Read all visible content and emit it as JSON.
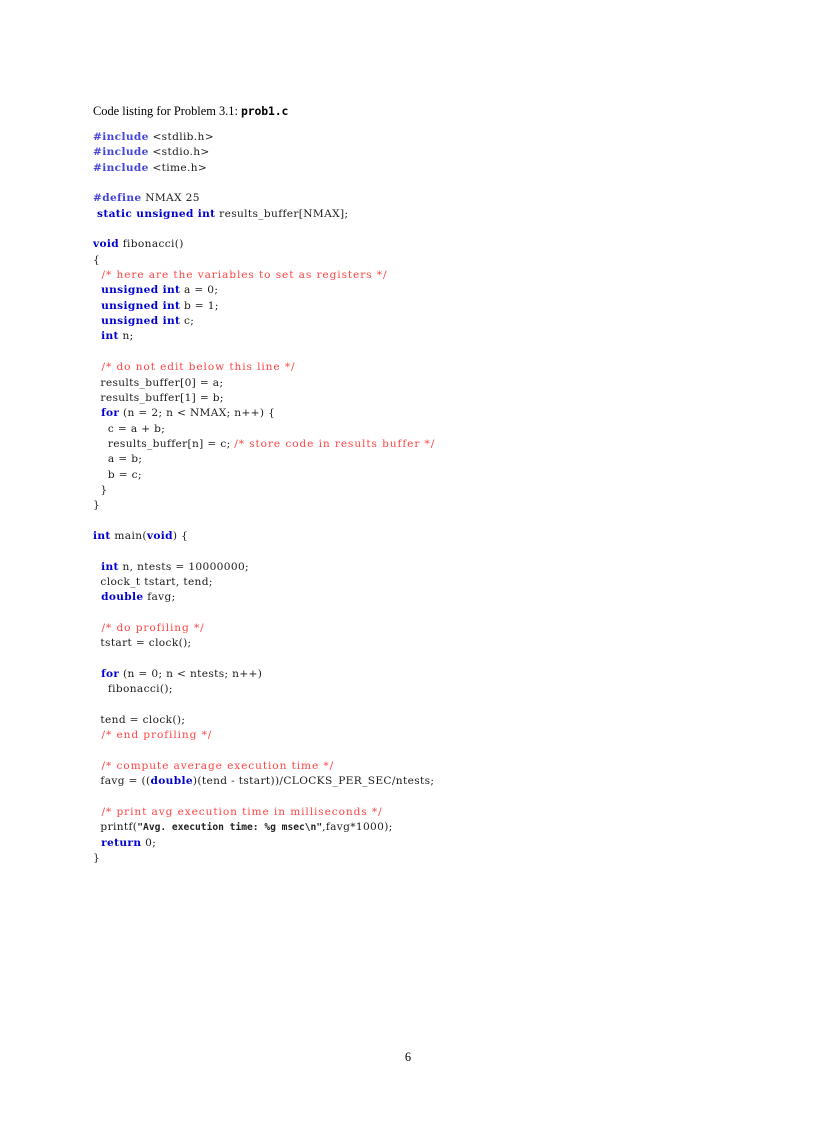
{
  "document": {
    "page_number": "6",
    "caption_prefix": "Code listing for Problem 3.1:",
    "caption_filename": "prob1.c"
  },
  "colors": {
    "keyword": "#0000cf",
    "preprocessor": "#4444dd",
    "comment": "#ff4444",
    "string": "#222222",
    "text": "#1a1a1a",
    "background": "#ffffff"
  },
  "code": {
    "language": "C",
    "filename": "prob1.c",
    "lines": [
      {
        "n": 1,
        "segments": [
          {
            "t": "pre",
            "v": "#include"
          },
          {
            "t": "id",
            "v": " <stdlib.h>"
          }
        ]
      },
      {
        "n": 2,
        "segments": [
          {
            "t": "pre",
            "v": "#include"
          },
          {
            "t": "id",
            "v": " <stdio.h>"
          }
        ]
      },
      {
        "n": 3,
        "segments": [
          {
            "t": "pre",
            "v": "#include"
          },
          {
            "t": "id",
            "v": " <time.h>"
          }
        ]
      },
      {
        "n": 4,
        "segments": []
      },
      {
        "n": 5,
        "segments": [
          {
            "t": "pre",
            "v": "#define"
          },
          {
            "t": "id",
            "v": " NMAX 25"
          }
        ]
      },
      {
        "n": 6,
        "segments": [
          {
            "t": "kw",
            "v": " static unsigned int"
          },
          {
            "t": "id",
            "v": " results_buffer[NMAX];"
          }
        ]
      },
      {
        "n": 7,
        "segments": []
      },
      {
        "n": 8,
        "segments": [
          {
            "t": "kw",
            "v": "void"
          },
          {
            "t": "id",
            "v": " fibonacci()"
          }
        ]
      },
      {
        "n": 9,
        "segments": [
          {
            "t": "id",
            "v": "{"
          }
        ]
      },
      {
        "n": 10,
        "segments": [
          {
            "t": "cmt",
            "v": "  /* here are the variables to set as registers */"
          }
        ]
      },
      {
        "n": 11,
        "segments": [
          {
            "t": "kw",
            "v": "  unsigned int"
          },
          {
            "t": "id",
            "v": " a = 0;"
          }
        ]
      },
      {
        "n": 12,
        "segments": [
          {
            "t": "kw",
            "v": "  unsigned int"
          },
          {
            "t": "id",
            "v": " b = 1;"
          }
        ]
      },
      {
        "n": 13,
        "segments": [
          {
            "t": "kw",
            "v": "  unsigned int"
          },
          {
            "t": "id",
            "v": " c;"
          }
        ]
      },
      {
        "n": 14,
        "segments": [
          {
            "t": "kw",
            "v": "  int"
          },
          {
            "t": "id",
            "v": " n;"
          }
        ]
      },
      {
        "n": 15,
        "segments": []
      },
      {
        "n": 16,
        "segments": [
          {
            "t": "cmt",
            "v": "  /* do not edit below this line */"
          }
        ]
      },
      {
        "n": 17,
        "segments": [
          {
            "t": "id",
            "v": "  results_buffer[0] = a;"
          }
        ]
      },
      {
        "n": 18,
        "segments": [
          {
            "t": "id",
            "v": "  results_buffer[1] = b;"
          }
        ]
      },
      {
        "n": 19,
        "segments": [
          {
            "t": "kw",
            "v": "  for"
          },
          {
            "t": "id",
            "v": " (n = 2; n < NMAX; n++) {"
          }
        ]
      },
      {
        "n": 20,
        "segments": [
          {
            "t": "id",
            "v": "    c = a + b;"
          }
        ]
      },
      {
        "n": 21,
        "segments": [
          {
            "t": "id",
            "v": "    results_buffer[n] = c; "
          },
          {
            "t": "cmt",
            "v": "/* store code in results buffer */"
          }
        ]
      },
      {
        "n": 22,
        "segments": [
          {
            "t": "id",
            "v": "    a = b;"
          }
        ]
      },
      {
        "n": 23,
        "segments": [
          {
            "t": "id",
            "v": "    b = c;"
          }
        ]
      },
      {
        "n": 24,
        "segments": [
          {
            "t": "id",
            "v": "  }"
          }
        ]
      },
      {
        "n": 25,
        "segments": [
          {
            "t": "id",
            "v": "}"
          }
        ]
      },
      {
        "n": 26,
        "segments": []
      },
      {
        "n": 27,
        "segments": [
          {
            "t": "kw",
            "v": "int"
          },
          {
            "t": "id",
            "v": " main("
          },
          {
            "t": "kw",
            "v": "void"
          },
          {
            "t": "id",
            "v": ") {"
          }
        ]
      },
      {
        "n": 28,
        "segments": []
      },
      {
        "n": 29,
        "segments": [
          {
            "t": "kw",
            "v": "  int"
          },
          {
            "t": "id",
            "v": " n, ntests = 10000000;"
          }
        ]
      },
      {
        "n": 30,
        "segments": [
          {
            "t": "id",
            "v": "  clock_t tstart, tend;"
          }
        ]
      },
      {
        "n": 31,
        "segments": [
          {
            "t": "kw",
            "v": "  double"
          },
          {
            "t": "id",
            "v": " favg;"
          }
        ]
      },
      {
        "n": 32,
        "segments": []
      },
      {
        "n": 33,
        "segments": [
          {
            "t": "cmt",
            "v": "  /* do profiling */"
          }
        ]
      },
      {
        "n": 34,
        "segments": [
          {
            "t": "id",
            "v": "  tstart = clock();"
          }
        ]
      },
      {
        "n": 35,
        "segments": []
      },
      {
        "n": 36,
        "segments": [
          {
            "t": "kw",
            "v": "  for"
          },
          {
            "t": "id",
            "v": " (n = 0; n < ntests; n++)"
          }
        ]
      },
      {
        "n": 37,
        "segments": [
          {
            "t": "id",
            "v": "    fibonacci();"
          }
        ]
      },
      {
        "n": 38,
        "segments": []
      },
      {
        "n": 39,
        "segments": [
          {
            "t": "id",
            "v": "  tend = clock();"
          }
        ]
      },
      {
        "n": 40,
        "segments": [
          {
            "t": "cmt",
            "v": "  /* end profiling */"
          }
        ]
      },
      {
        "n": 41,
        "segments": []
      },
      {
        "n": 42,
        "segments": [
          {
            "t": "cmt",
            "v": "  /* compute average execution time */"
          }
        ]
      },
      {
        "n": 43,
        "segments": [
          {
            "t": "id",
            "v": "  favg = (("
          },
          {
            "t": "kw",
            "v": "double"
          },
          {
            "t": "id",
            "v": ")(tend - tstart))/CLOCKS_PER_SEC/ntests;"
          }
        ]
      },
      {
        "n": 44,
        "segments": []
      },
      {
        "n": 45,
        "segments": [
          {
            "t": "cmt",
            "v": "  /* print avg execution time in milliseconds */"
          }
        ]
      },
      {
        "n": 46,
        "segments": [
          {
            "t": "id",
            "v": "  printf("
          },
          {
            "t": "str",
            "v": "\"Avg. execution time: %g msec\\n\""
          },
          {
            "t": "id",
            "v": ",favg*1000);"
          }
        ]
      },
      {
        "n": 47,
        "segments": [
          {
            "t": "kw",
            "v": "  return"
          },
          {
            "t": "id",
            "v": " 0;"
          }
        ]
      },
      {
        "n": 48,
        "segments": [
          {
            "t": "id",
            "v": "}"
          }
        ]
      }
    ]
  }
}
